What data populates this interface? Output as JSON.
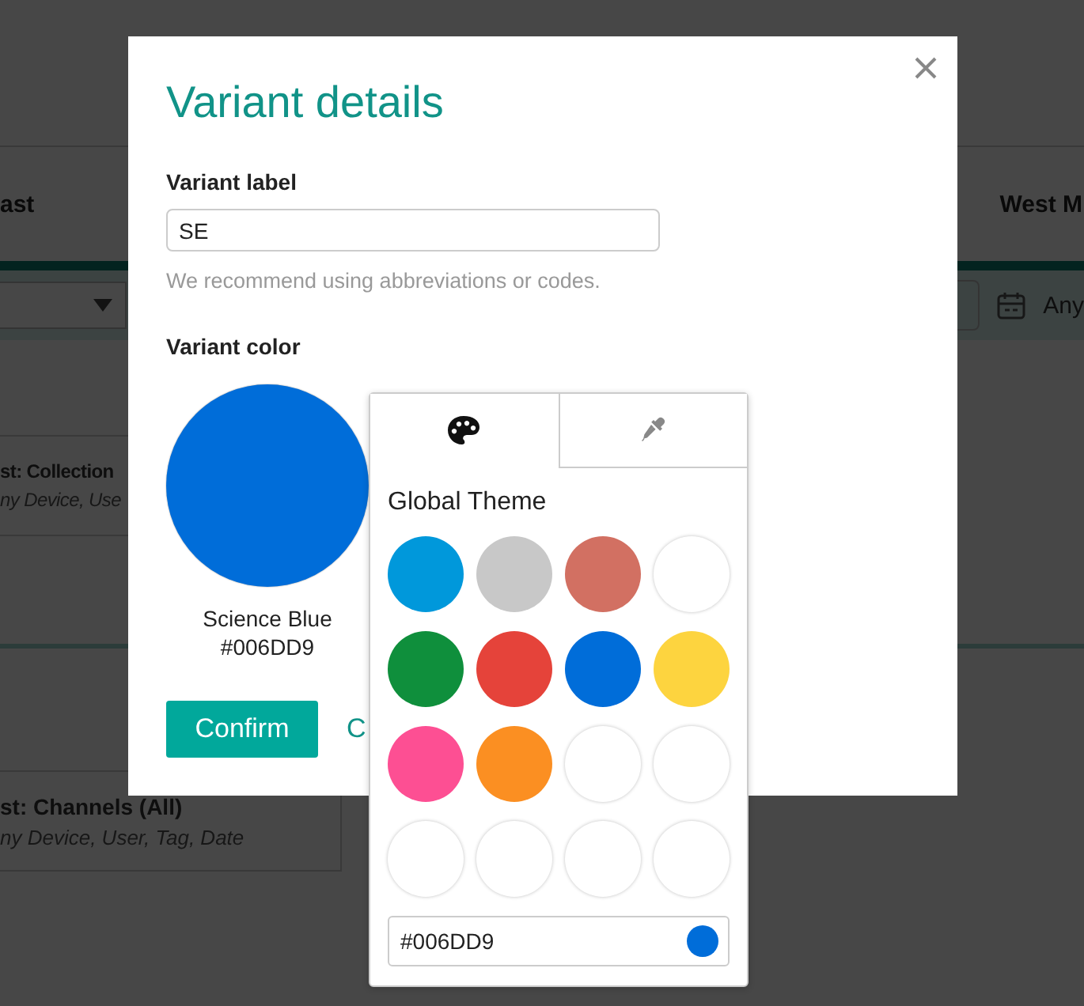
{
  "background": {
    "columns": [
      {
        "heading": "ast"
      },
      {
        "heading": "West M"
      }
    ],
    "date_filter": {
      "value": "Any"
    },
    "cards": [
      {
        "title": "st: Collection",
        "subtitle": "ny Device, Use"
      },
      {
        "title": "st: Channels (All)",
        "subtitle": "ny Device, User, Tag, Date"
      }
    ]
  },
  "dialog": {
    "title": "Variant details",
    "label_field": {
      "label": "Variant label",
      "value": "SE",
      "hint": "We recommend using abbreviations or codes."
    },
    "color_section": {
      "label": "Variant color",
      "color_name": "Science Blue",
      "color_hex": "#006DD9"
    },
    "buttons": [
      {
        "label": "Confirm",
        "kind": "primary"
      },
      {
        "label": "C",
        "kind": "link"
      }
    ]
  },
  "color_picker": {
    "tabs": [
      {
        "selected": true
      },
      {
        "selected": false
      }
    ],
    "section_title": "Global Theme",
    "swatches": [
      {
        "kind": "color",
        "color": "#0098db"
      },
      {
        "kind": "color",
        "color": "#c8c8c8"
      },
      {
        "kind": "color",
        "color": "#d27062"
      },
      {
        "kind": "empty"
      },
      {
        "kind": "color",
        "color": "#0f8f3c"
      },
      {
        "kind": "color",
        "color": "#e5433a"
      },
      {
        "kind": "color",
        "color": "#006dd9"
      },
      {
        "kind": "color",
        "color": "#fdd43f"
      },
      {
        "kind": "color",
        "color": "#fd4f93"
      },
      {
        "kind": "color",
        "color": "#fb8f22"
      },
      {
        "kind": "empty"
      },
      {
        "kind": "empty"
      },
      {
        "kind": "empty"
      },
      {
        "kind": "empty"
      },
      {
        "kind": "empty"
      },
      {
        "kind": "empty"
      }
    ],
    "hex_field": {
      "value": "#006DD9",
      "color": "#006dd9"
    }
  }
}
